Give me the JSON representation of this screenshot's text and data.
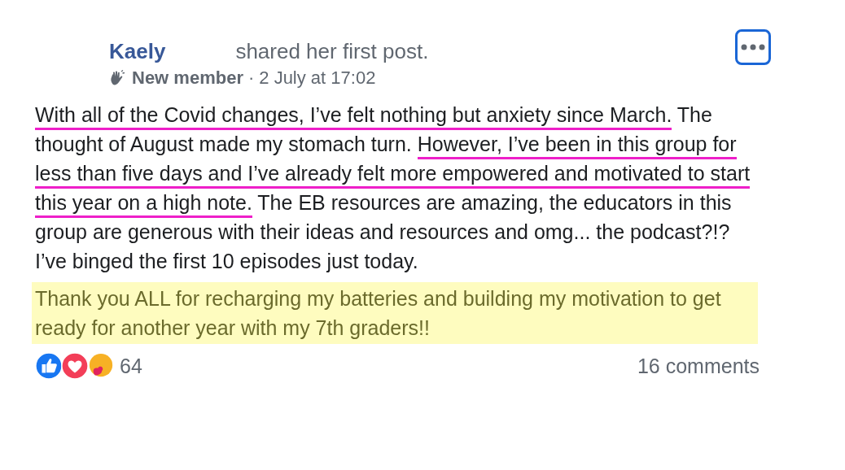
{
  "post": {
    "author": "Kaely",
    "action": "shared her first post.",
    "badge": "New member",
    "separator": "·",
    "time": "2 July at 17:02",
    "menu_button": {
      "focused": true
    },
    "paragraphs": [
      {
        "highlighted": false,
        "segments": [
          {
            "text": "With all of the Covid changes, I’ve felt nothing but anxiety since March.",
            "underlined": true
          },
          {
            "text": " The thought of August made my stomach turn. ",
            "underlined": false
          },
          {
            "text": "However, I’ve been in this group for less than five days and I’ve already felt more empowered and motivated to start this year on a high note.",
            "underlined": true
          },
          {
            "text": " The EB resources are amazing, the educators in this group are generous with their ideas and resources and omg... the podcast?!? I’ve binged the first 10 episodes just today.",
            "underlined": false
          }
        ]
      },
      {
        "highlighted": true,
        "segments": [
          {
            "text": "Thank you ALL for recharging my batteries and building my motivation to get ready for another year with my 7th graders!!",
            "underlined": false
          }
        ]
      }
    ],
    "reactions": [
      {
        "kind": "like"
      },
      {
        "kind": "love"
      },
      {
        "kind": "care"
      }
    ],
    "reaction_count": "64",
    "comments": "16 comments"
  }
}
